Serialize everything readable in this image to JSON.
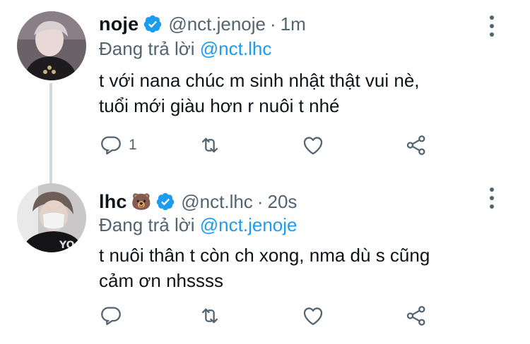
{
  "tweets": [
    {
      "name": "noje",
      "handle": "@nct.jenoje",
      "separator": "·",
      "time": "1m",
      "reply_prefix": "Đang trả lời ",
      "reply_to": "@nct.lhc",
      "text_line1": "t với nana chúc m sinh nhật thật vui nè,",
      "text_line2": "tuổi mới giàu hơn r nuôi t nhé",
      "reply_count": "1",
      "verified": true
    },
    {
      "name": "lhc",
      "emoji": "🐻",
      "handle": "@nct.lhc",
      "separator": "·",
      "time": "20s",
      "reply_prefix": "Đang trả lời ",
      "reply_to": "@nct.jenoje",
      "text_line1": "t nuôi thân t còn ch xong, nma dù s cũng",
      "text_line2": "cảm ơn nhssss",
      "verified": true
    }
  ],
  "icons": {
    "reply": "reply-icon",
    "retweet": "retweet-icon",
    "like": "heart-icon",
    "share": "share-icon",
    "more": "more-icon",
    "verified": "verified-badge-icon"
  },
  "colors": {
    "accent": "#1d9bf0",
    "secondary_text": "#536471",
    "primary_text": "#0f1419",
    "thread_line": "#cfd9de"
  }
}
